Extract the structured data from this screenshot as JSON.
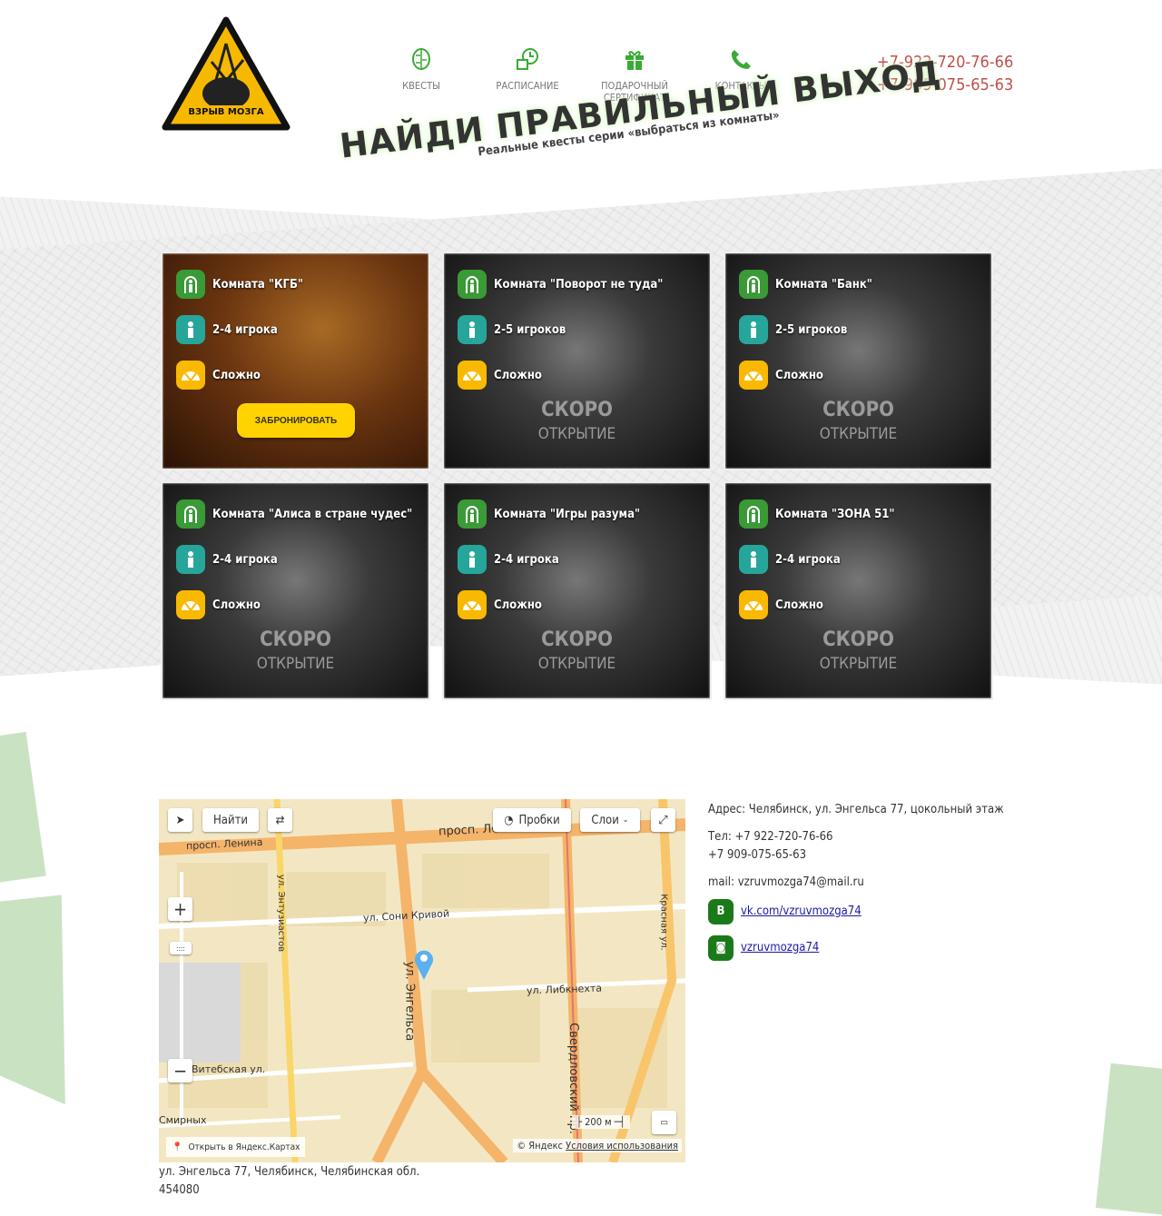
{
  "logo": {
    "text": "ВЗРЫВ МОЗГА"
  },
  "nav": [
    {
      "label": "КВЕСТЫ",
      "icon": "brain-icon"
    },
    {
      "label": "РАСПИСАНИЕ",
      "icon": "calendar-clock-icon"
    },
    {
      "label": "ПОДАРОЧНЫЙ СЕРТИФИКАТ",
      "icon": "gift-icon"
    },
    {
      "label": "КОНТАКТЫ",
      "icon": "phone-icon"
    }
  ],
  "phones": [
    "+7-922-720-76-66",
    "+7-909-075-65-63"
  ],
  "hero": {
    "title": "НАЙДИ ПРАВИЛЬНЫЙ ВЫХОД",
    "subtitle": "Реальные квесты серии «выбраться из комнаты»"
  },
  "soon": {
    "line1": "СКОРО",
    "line2": "ОТКРЫТИЕ"
  },
  "quests": [
    {
      "name": "Комната \"КГБ\"",
      "players": "2-4 игрока",
      "difficulty": "Сложно",
      "button": "ЗАБРОНИРОВАТЬ"
    },
    {
      "name": "Комната \"Поворот не туда\"",
      "players": "2-5 игроков",
      "difficulty": "Сложно"
    },
    {
      "name": "Комната \"Банк\"",
      "players": "2-5 игроков",
      "difficulty": "Сложно"
    },
    {
      "name": "Комната \"Алиса в стране чудес\"",
      "players": "2-4 игрока",
      "difficulty": "Сложно"
    },
    {
      "name": "Комната \"Игры разума\"",
      "players": "2-4 игрока",
      "difficulty": "Сложно"
    },
    {
      "name": "Комната \"ЗОНА 51\"",
      "players": "2-4 игрока",
      "difficulty": "Сложно"
    }
  ],
  "map": {
    "find": "Найти",
    "traffic": "Пробки",
    "layers": "Слои",
    "scale": "200 м",
    "open": "Открыть в Яндекс.Картах",
    "copyright": "© Яндекс",
    "terms": "Условия использования",
    "streets": {
      "lenina1": "просп. Ленина",
      "lenina2": "просп. Ленина",
      "soni": "ул. Сони Кривой",
      "entuz": "ул. Энтузиастов",
      "engelsa": "ул. Энгельса",
      "libkn": "ул. Либкнехта",
      "sverdl": "Свердловский пр.",
      "krasn": "Красная ул.",
      "vitebsk": "Витебская ул.",
      "smirn": "Смирных"
    }
  },
  "contacts": {
    "address": "Адрес: Челябинск, ул. Энгельса 77, цокольный этаж",
    "tel1": "Тел: +7 922-720-76-66",
    "tel2": "+7 909-075-65-63",
    "mail": "mail: vzruvmozga74@mail.ru",
    "vk": "vk.com/vzruvmozga74",
    "vk_icon": "B",
    "insta": "vzruvmozga74"
  },
  "footer_addr": {
    "line1": "ул. Энгельса 77, Челябинск, Челябинская обл.",
    "line2": "454080"
  }
}
